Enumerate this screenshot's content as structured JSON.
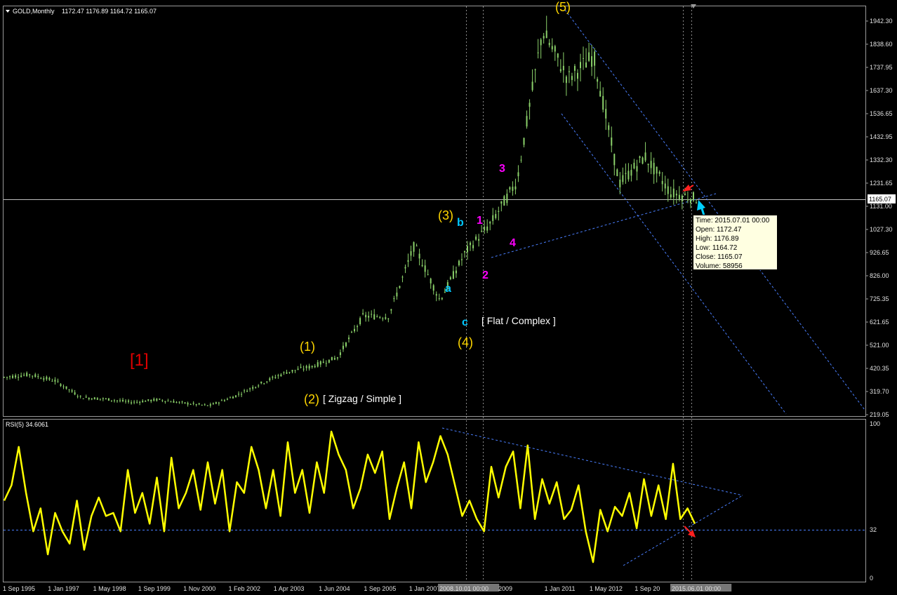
{
  "header": {
    "symbol_label": "GOLD,Monthly",
    "ohlc_label": "1172.47 1176.89 1164.72 1165.07",
    "rsi_label": "RSI(5) 34.6061"
  },
  "price_axis": {
    "ticks": [
      "1942.30",
      "1838.60",
      "1737.95",
      "1637.30",
      "1536.65",
      "1432.95",
      "1332.30",
      "1231.65",
      "1131.00",
      "1027.30",
      "926.65",
      "826.00",
      "725.35",
      "621.65",
      "521.00",
      "420.35",
      "319.70",
      "219.05"
    ],
    "current_price": "1165.07"
  },
  "rsi_axis": {
    "ticks": [
      "100",
      "32",
      "0"
    ]
  },
  "time_axis": {
    "ticks": [
      "1 Sep 1995",
      "1 Jan 1997",
      "1 May 1998",
      "1 Sep 1999",
      "1 Nov 2000",
      "1 Feb 2002",
      "1 Apr 2003",
      "1 Jun 2004",
      "1 Sep 2005",
      "1 Jan 2007",
      "2008.10.01 00:00",
      "2009",
      "1 Jan 2011",
      "1 May 2012",
      "1 Sep 20",
      "2015.06.01 00:00"
    ],
    "highlighted": [
      "2008.10.01 00:00",
      "2015.06.01 00:00"
    ]
  },
  "wave_labels": [
    {
      "text": "[1]",
      "color": "#e00000"
    },
    {
      "text": "(1)",
      "color": "#ffd700"
    },
    {
      "text": "(2)",
      "color": "#ffd700"
    },
    {
      "text": "[ Zigzag / Simple ]",
      "color": "#ffffff"
    },
    {
      "text": "(3)",
      "color": "#ffd700"
    },
    {
      "text": "(4)",
      "color": "#ffd700"
    },
    {
      "text": "[ Flat / Complex ]",
      "color": "#ffffff"
    },
    {
      "text": "(5)",
      "color": "#ffd700"
    },
    {
      "text": "a",
      "color": "#00c8ff"
    },
    {
      "text": "b",
      "color": "#00c8ff"
    },
    {
      "text": "c",
      "color": "#00c8ff"
    },
    {
      "text": "1",
      "color": "#ff00ff"
    },
    {
      "text": "2",
      "color": "#ff00ff"
    },
    {
      "text": "3",
      "color": "#ff00ff"
    },
    {
      "text": "4",
      "color": "#ff00ff"
    }
  ],
  "tooltip": {
    "time": "Time: 2015.07.01 00:00",
    "open": "Open: 1172.47",
    "high": "High: 1176.89",
    "low": "Low: 1164.72",
    "close": "Close: 1165.07",
    "volume": "Volume: 58956"
  },
  "colors": {
    "background": "#000000",
    "candles": "#8bd16a",
    "rsi_line": "#ffff00",
    "trendline": "#4a7fff",
    "grid_line": "#808080"
  },
  "chart_data": [
    {
      "type": "line",
      "title": "GOLD,Monthly",
      "x": [
        "1995-01",
        "1996-01",
        "1997-01",
        "1998-01",
        "1999-01",
        "1999-08",
        "2000-06",
        "2001-01",
        "2001-04",
        "2002-01",
        "2003-01",
        "2004-01",
        "2005-01",
        "2005-10",
        "2006-05",
        "2007-01",
        "2008-03",
        "2008-10",
        "2009-03",
        "2009-10",
        "2010-06",
        "2011-08",
        "2012-03",
        "2012-10",
        "2013-06",
        "2014-03",
        "2014-11",
        "2015-07"
      ],
      "series": [
        {
          "name": "GOLD,Monthly",
          "values": [
            383,
            395,
            367,
            295,
            287,
            273,
            285,
            270,
            258,
            300,
            355,
            405,
            430,
            470,
            650,
            650,
            960,
            720,
            930,
            1060,
            1240,
            1900,
            1690,
            1790,
            1230,
            1350,
            1190,
            1165
          ]
        }
      ],
      "ylim": [
        219.05,
        1980
      ],
      "annotations": [
        "[1]",
        "(1)",
        "(2)",
        "[ Zigzag / Simple ]",
        "(3)",
        "(4)",
        "[ Flat / Complex ]",
        "(5)",
        "a",
        "b",
        "c",
        "1",
        "2",
        "3",
        "4"
      ]
    },
    {
      "type": "line",
      "title": "RSI(5) 34.6061",
      "ylim": [
        0,
        100
      ],
      "series": [
        {
          "name": "RSI(5)",
          "values": [
            50,
            60,
            85,
            55,
            30,
            45,
            15,
            42,
            30,
            22,
            50,
            18,
            40,
            52,
            40,
            42,
            30,
            70,
            42,
            55,
            35,
            65,
            30,
            78,
            45,
            55,
            70,
            44,
            75,
            48,
            70,
            30,
            62,
            55,
            85,
            70,
            45,
            70,
            40,
            88,
            55,
            70,
            42,
            75,
            55,
            95,
            80,
            70,
            45,
            58,
            80,
            68,
            82,
            38,
            58,
            75,
            45,
            88,
            62,
            75,
            92,
            80,
            60,
            40,
            50,
            38,
            30,
            72,
            52,
            72,
            82,
            45,
            86,
            38,
            64,
            48,
            62,
            38,
            44,
            60,
            30,
            10,
            44,
            30,
            46,
            40,
            55,
            32,
            64,
            40,
            60,
            38,
            74,
            38,
            45,
            35
          ]
        }
      ],
      "levels": [
        32
      ]
    }
  ]
}
